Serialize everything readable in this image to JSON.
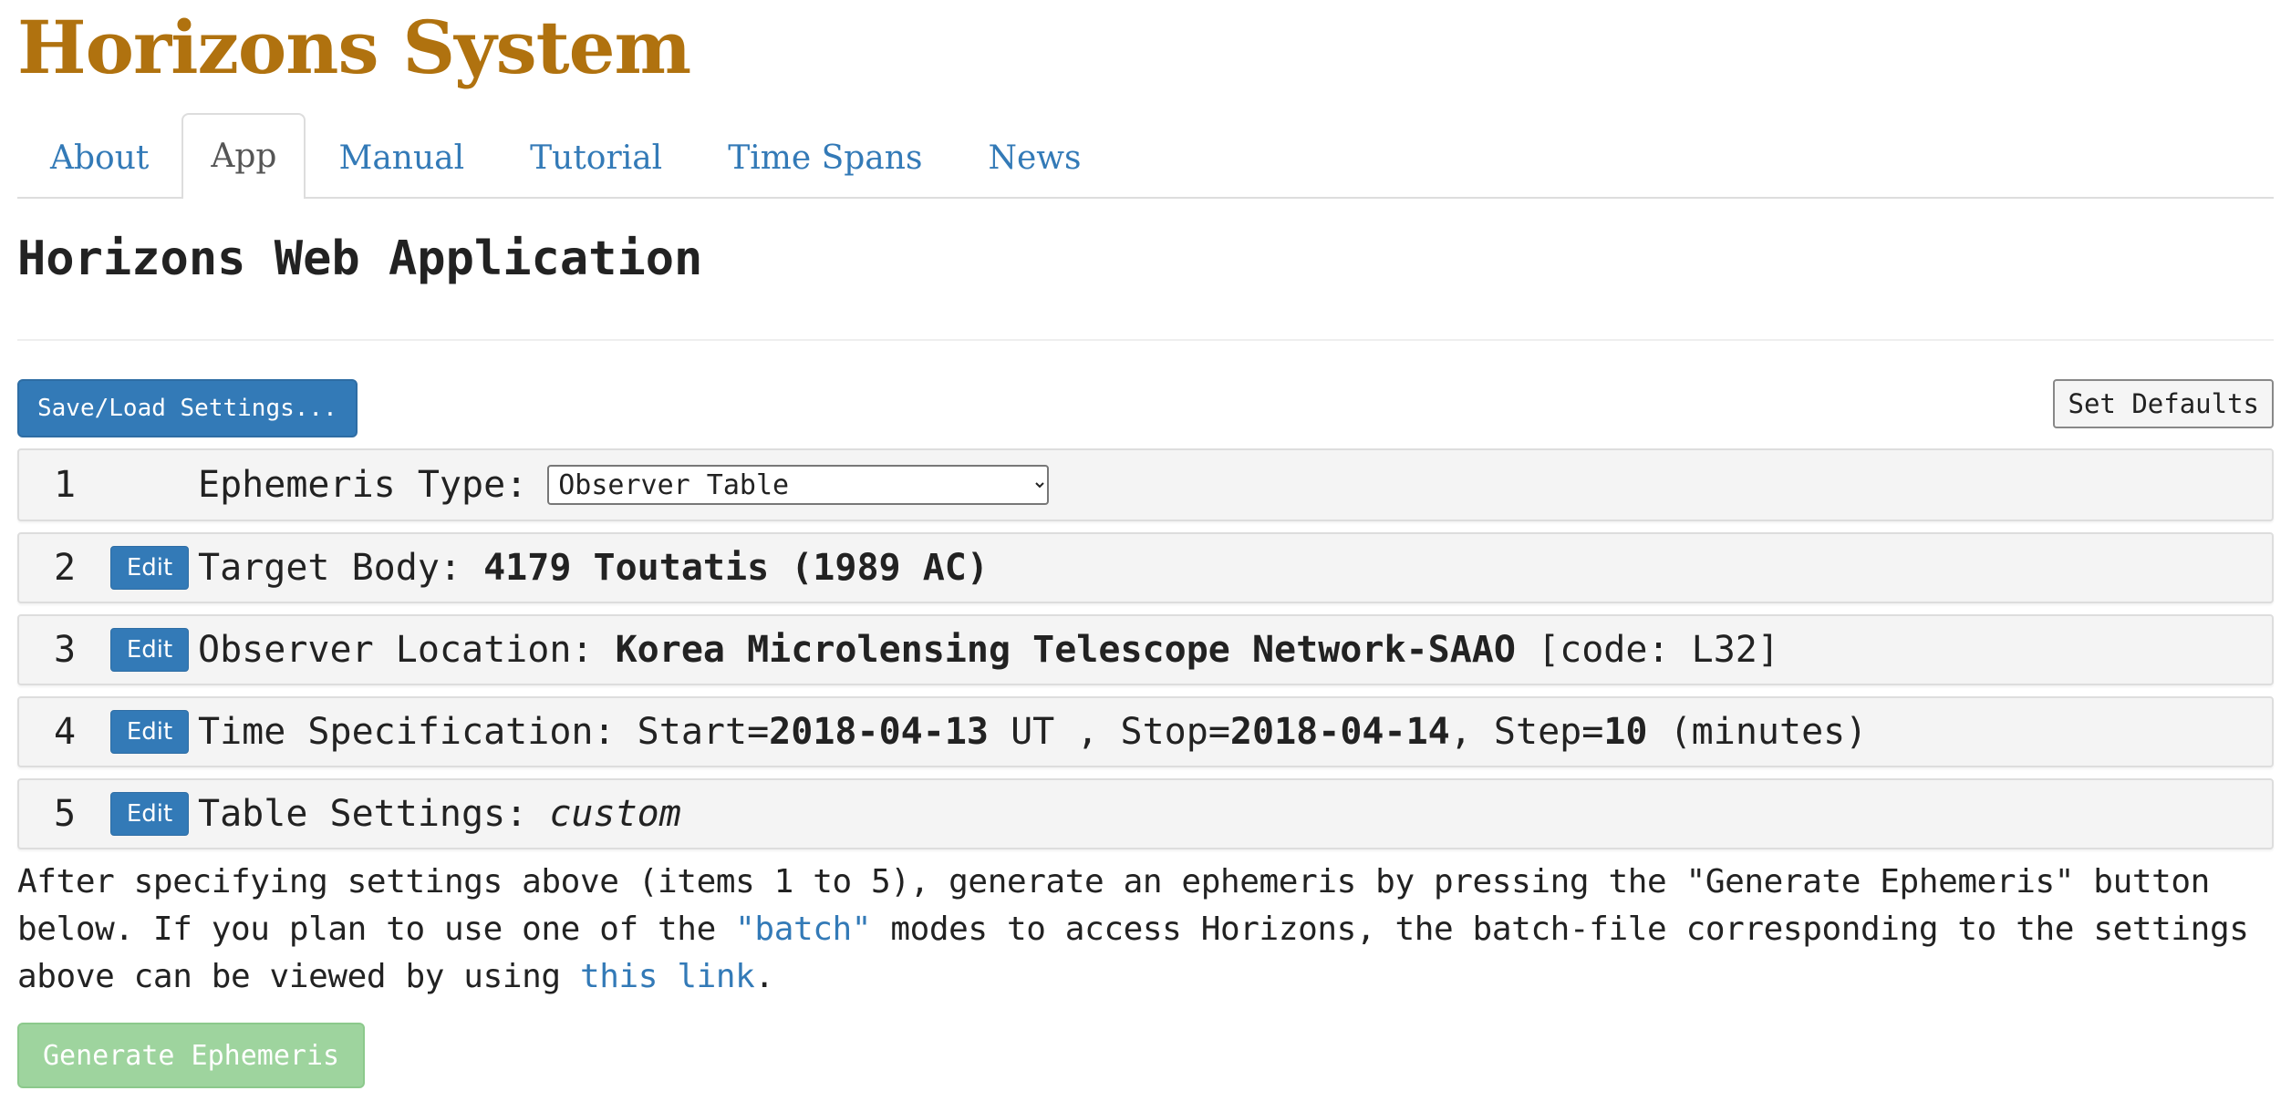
{
  "site_title": "Horizons System",
  "tabs": [
    {
      "label": "About"
    },
    {
      "label": "App",
      "active": true
    },
    {
      "label": "Manual"
    },
    {
      "label": "Tutorial"
    },
    {
      "label": "Time Spans"
    },
    {
      "label": "News"
    }
  ],
  "app_heading": "Horizons Web Application",
  "toolbar": {
    "save_load_label": "Save/Load Settings...",
    "set_defaults_label": "Set Defaults"
  },
  "settings": {
    "edit_label": "Edit",
    "ephemeris_type": {
      "num": "1",
      "label": "Ephemeris Type:",
      "selected": "Observer Table"
    },
    "target_body": {
      "num": "2",
      "label": "Target Body:",
      "value": "4179 Toutatis (1989 AC)"
    },
    "observer_location": {
      "num": "3",
      "label": "Observer Location:",
      "value": "Korea Microlensing Telescope Network-SAAO",
      "code_text": "[code: L32]"
    },
    "time_spec": {
      "num": "4",
      "label": "Time Specification:",
      "start_prefix": "Start=",
      "start": "2018-04-13",
      "start_suffix": "UT ,",
      "stop_prefix": "Stop=",
      "stop": "2018-04-14",
      "step_prefix": ", Step=",
      "step": "10",
      "step_unit": "(minutes)"
    },
    "table_settings": {
      "num": "5",
      "label": "Table Settings:",
      "value": "custom"
    }
  },
  "help": {
    "part1": "After specifying settings above (items 1 to 5), generate an ephemeris by pressing the \"Generate Ephemeris\" button below. If you plan to use one of the ",
    "batch_link": "\"batch\"",
    "part2": " modes to access Horizons, the batch-file corresponding to the settings above can be viewed by using ",
    "this_link": "this link",
    "part3": "."
  },
  "generate_label": "Generate Ephemeris",
  "colors": {
    "title": "#b0720f",
    "link": "#337ab7",
    "primary_button": "#337ab7",
    "generate_button_disabled": "#9ed49e",
    "row_background": "#f4f4f4"
  }
}
